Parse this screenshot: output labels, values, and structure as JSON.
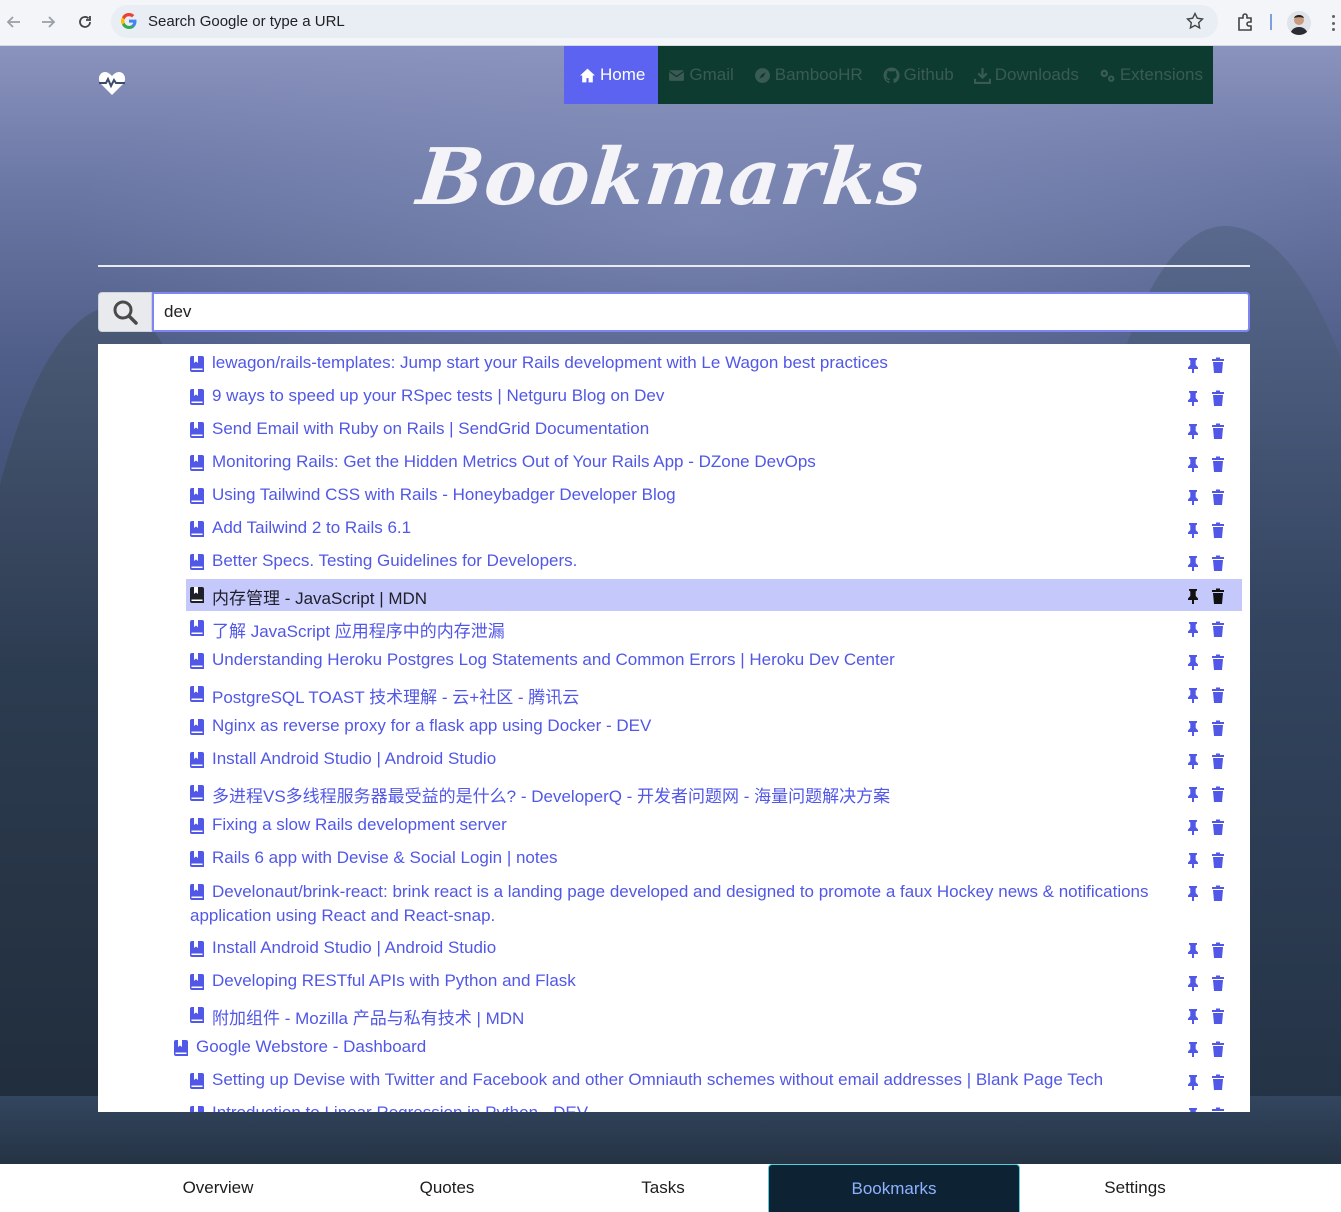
{
  "browser": {
    "omnibox_placeholder": "Search Google or type a URL"
  },
  "nav": {
    "items": [
      {
        "label": "Home",
        "icon": "home-icon",
        "active": true
      },
      {
        "label": "Gmail",
        "icon": "envelope-icon"
      },
      {
        "label": "BambooHR",
        "icon": "compass-icon"
      },
      {
        "label": "Github",
        "icon": "github-icon"
      },
      {
        "label": "Downloads",
        "icon": "download-icon"
      },
      {
        "label": "Extensions",
        "icon": "gears-icon"
      }
    ]
  },
  "page": {
    "title": "Bookmarks"
  },
  "search": {
    "value": "dev"
  },
  "bookmarks": [
    "lewagon/rails-templates: Jump start your Rails development with Le Wagon best practices",
    "9 ways to speed up your RSpec tests | Netguru Blog on Dev",
    "Send Email with Ruby on Rails | SendGrid Documentation",
    "Monitoring Rails: Get the Hidden Metrics Out of Your Rails App - DZone DevOps",
    "Using Tailwind CSS with Rails - Honeybadger Developer Blog",
    "Add Tailwind 2 to Rails 6.1",
    "Better Specs. Testing Guidelines for Developers.",
    "内存管理 - JavaScript | MDN",
    "了解 JavaScript 应用程序中的内存泄漏",
    "Understanding Heroku Postgres Log Statements and Common Errors | Heroku Dev Center",
    "PostgreSQL TOAST 技术理解 - 云+社区 - 腾讯云",
    "Nginx as reverse proxy for a flask app using Docker - DEV",
    "Install Android Studio | Android Studio",
    "多进程VS多线程服务器最受益的是什么? - DeveloperQ - 开发者问题网 - 海量问题解决方案",
    "Fixing a slow Rails development server",
    "Rails 6 app with Devise & Social Login | notes",
    "Develonaut/brink-react: brink react is a landing page developed and designed to promote a faux Hockey news & notifications application using React and React-snap.",
    "Install Android Studio | Android Studio",
    "Developing RESTful APIs with Python and Flask",
    "附加组件 - Mozilla 产品与私有技术 | MDN",
    "Google Webstore - Dashboard",
    "Setting up Devise with Twitter and Facebook and other Omniauth schemes without email addresses | Blank Page Tech",
    "Introduction to Linear Regression in Python - DEV"
  ],
  "bottom_tabs": [
    {
      "label": "Overview"
    },
    {
      "label": "Quotes"
    },
    {
      "label": "Tasks"
    },
    {
      "label": "Bookmarks",
      "active": true
    },
    {
      "label": "Settings"
    }
  ],
  "colors": {
    "accent": "#5b63f0",
    "link": "#5157e6",
    "nav_bg": "#0d3b30",
    "highlight_row": "#c5c8fb",
    "active_tab_bg": "#0d2233"
  }
}
